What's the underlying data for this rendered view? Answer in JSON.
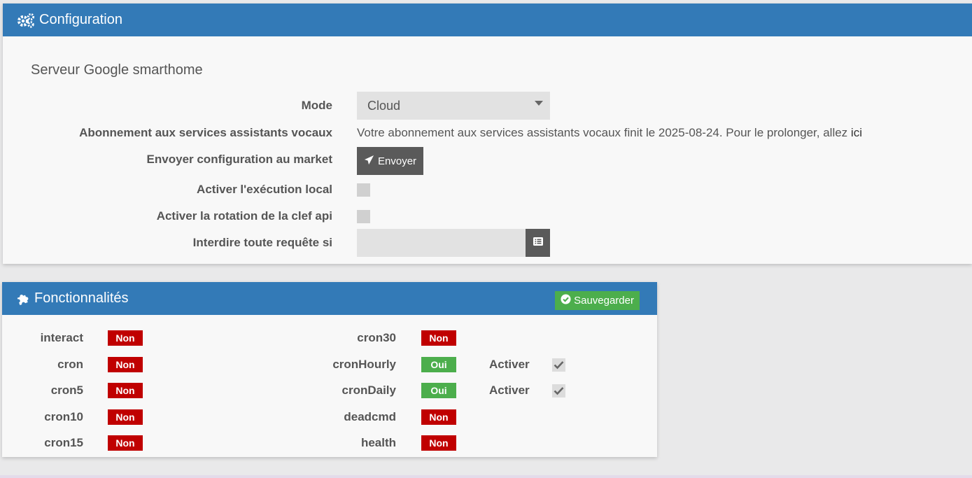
{
  "config": {
    "title": "Configuration",
    "section_title": "Serveur Google smarthome",
    "mode": {
      "label": "Mode",
      "value": "Cloud"
    },
    "subscription": {
      "label": "Abonnement aux services assistants vocaux",
      "text": "Votre abonnement aux services assistants vocaux finit le 2025-08-24. Pour le prolonger, allez ",
      "link": "ici"
    },
    "market": {
      "label": "Envoyer configuration au market",
      "button": "Envoyer"
    },
    "local_exec": {
      "label": "Activer l'exécution local"
    },
    "api_rotation": {
      "label": "Activer la rotation de la clef api"
    },
    "forbid": {
      "label": "Interdire toute requête si",
      "value": ""
    }
  },
  "features": {
    "title": "Fonctionnalités",
    "save_label": "Sauvegarder",
    "activate_label": "Activer",
    "left": [
      {
        "name": "interact",
        "status": "Non"
      },
      {
        "name": "cron",
        "status": "Non"
      },
      {
        "name": "cron5",
        "status": "Non"
      },
      {
        "name": "cron10",
        "status": "Non"
      },
      {
        "name": "cron15",
        "status": "Non"
      }
    ],
    "right": [
      {
        "name": "cron30",
        "status": "Non"
      },
      {
        "name": "cronHourly",
        "status": "Oui",
        "activate": true
      },
      {
        "name": "cronDaily",
        "status": "Oui",
        "activate": true
      },
      {
        "name": "deadcmd",
        "status": "Non"
      },
      {
        "name": "health",
        "status": "Non"
      }
    ]
  },
  "colors": {
    "header": "#337ab7",
    "non": "#c00000",
    "oui": "#4cae4c",
    "dark_button": "#5a5a5a"
  }
}
